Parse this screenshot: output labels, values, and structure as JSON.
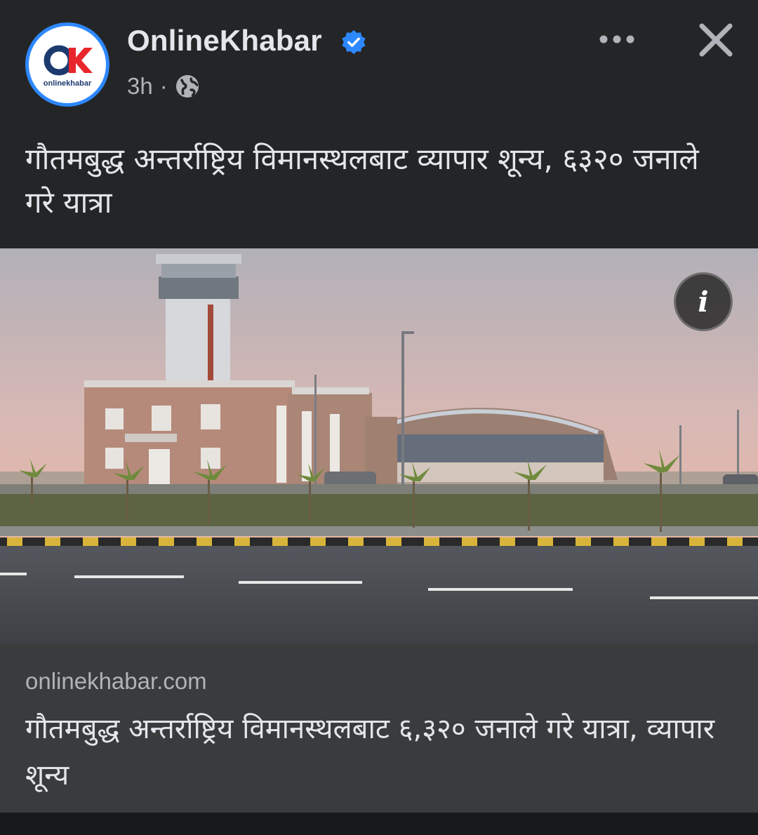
{
  "post": {
    "page_name": "OnlineKhabar",
    "verified_icon": "verified-badge-icon",
    "time": "3h",
    "separator": "·",
    "privacy_icon": "globe-icon",
    "avatar": {
      "logo_text": "OK",
      "logo_subtext": "onlinekhabar",
      "brand_color": "#e8262b",
      "logo_dark": "#1d3a6e"
    },
    "text": "गौतमबुद्ध अन्तर्राष्ट्रिय विमानस्थलबाट व्यापार शून्य, ६३२० जनाले गरे यात्रा"
  },
  "actions": {
    "more_icon": "more-options-icon",
    "close_icon": "close-icon"
  },
  "link_card": {
    "info_icon_label": "i",
    "domain": "onlinekhabar.com",
    "title": "गौतमबुद्ध अन्तर्राष्ट्रिय विमानस्थलबाट ६,३२० जनाले गरे यात्रा, व्यापार शून्य"
  },
  "colors": {
    "background": "#242526",
    "card_meta": "#3a3b3c",
    "accent": "#2d88ff",
    "secondary_text": "#b0b3b8"
  }
}
